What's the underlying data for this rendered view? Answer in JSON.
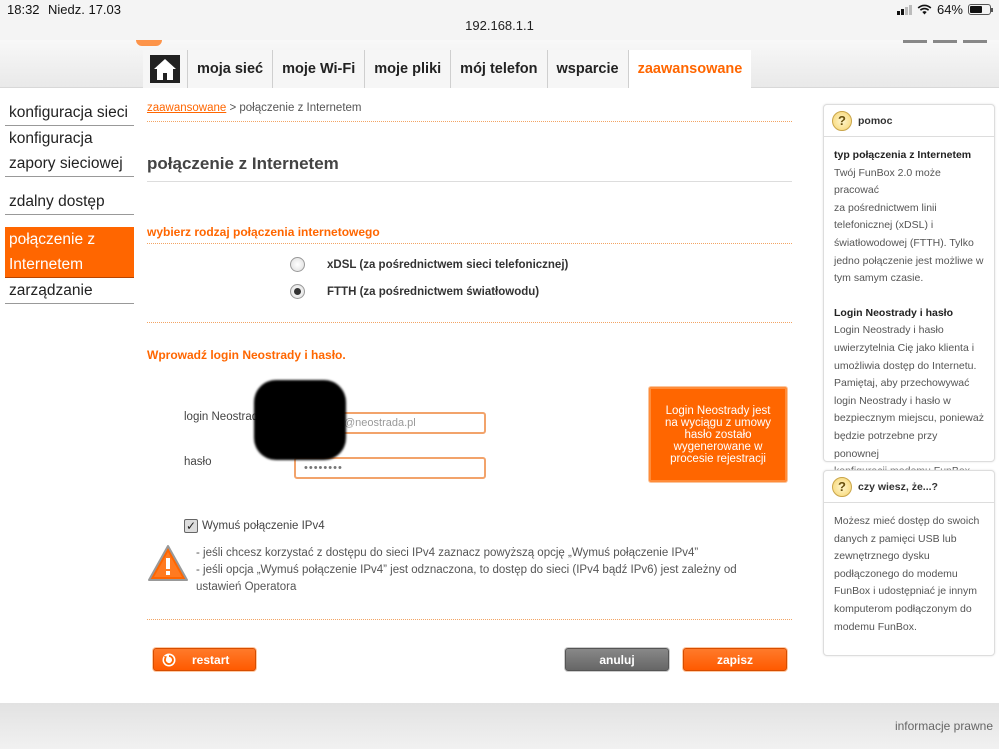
{
  "status_bar": {
    "time": "18:32",
    "date": "Niedz. 17.03",
    "url": "192.168.1.1",
    "battery": "64%"
  },
  "nav_tabs": {
    "home_icon": "home-icon",
    "items": [
      "moja sieć",
      "moje Wi-Fi",
      "moje pliki",
      "mój telefon",
      "wsparcie",
      "zaawansowane"
    ],
    "active": "zaawansowane"
  },
  "sidebar": {
    "items": [
      {
        "label": "konfiguracja sieci"
      },
      {
        "label_line1": "konfiguracja",
        "label_line2": "zapory sieciowej"
      },
      {
        "label": "zdalny dostęp"
      },
      {
        "label_line1": "połączenie z",
        "label_line2": "Internetem"
      },
      {
        "label": "zarządzanie"
      }
    ]
  },
  "breadcrumb": {
    "link": "zaawansowane",
    "separator": " > ",
    "current": "połączenie z Internetem"
  },
  "main": {
    "title": "połączenie z Internetem",
    "connection_section_title": "wybierz rodzaj połączenia internetowego",
    "options": [
      {
        "label": "xDSL (za pośrednictwem sieci telefonicznej)",
        "selected": false
      },
      {
        "label": "FTTH (za pośrednictwem światłowodu)",
        "selected": true
      }
    ],
    "login_section_title": "Wprowadź login Neostrady i hasło.",
    "login_label": "login Neostrady",
    "login_suffix": "@neostrada.pl",
    "password_label": "hasło",
    "password_value": "••••••••",
    "info_box_text": "Login Neostrady jest na wyciągu z umowy hasło zostało wygenerowane w procesie rejestracji",
    "ipv4_checkbox_label": "Wymuś połączenie IPv4",
    "ipv4_checked": true,
    "warning_line1": "- jeśli chcesz korzystać z dostępu do sieci IPv4 zaznacz powyższą opcję „Wymuś połączenie IPv4”",
    "warning_line2": "- jeśli opcja „Wymuś połączenie IPv4” jest odznaczona, to dostęp do sieci (IPv4 bądź IPv6) jest zależny od",
    "warning_line3": "ustawień Operatora"
  },
  "buttons": {
    "restart": "restart",
    "cancel": "anuluj",
    "save": "zapisz"
  },
  "help": {
    "title": "pomoc",
    "section1_title": "typ połączenia z Internetem",
    "section1_lines": [
      "Twój FunBox 2.0 może pracować",
      "za pośrednictwem linii",
      "telefonicznej (xDSL) i",
      "światłowodowej (FTTH). Tylko",
      "jedno połączenie jest możliwe w",
      "tym samym czasie."
    ],
    "section2_title": "Login Neostrady i hasło",
    "section2_lines": [
      "Login Neostrady i hasło",
      "uwierzytelnia Cię jako klienta i",
      "umożliwia dostęp do Internetu.",
      "Pamiętaj, aby przechowywać",
      "login Neostrady i hasło w",
      "bezpiecznym miejscu, ponieważ",
      "będzie potrzebne przy ponownej",
      "konfiguracji modemu FunBox."
    ]
  },
  "didyouknow": {
    "title": "czy wiesz, że...?",
    "lines": [
      "Możesz mieć dostęp do swoich",
      "danych z pamięci USB lub",
      "zewnętrznego dysku",
      "podłączonego do modemu",
      "FunBox i udostępniać je innym",
      "komputerom podłączonym do",
      "modemu FunBox."
    ]
  },
  "footer": {
    "legal_link": "informacje prawne"
  },
  "colors": {
    "accent": "#ff6600",
    "button_gray": "#777777"
  }
}
